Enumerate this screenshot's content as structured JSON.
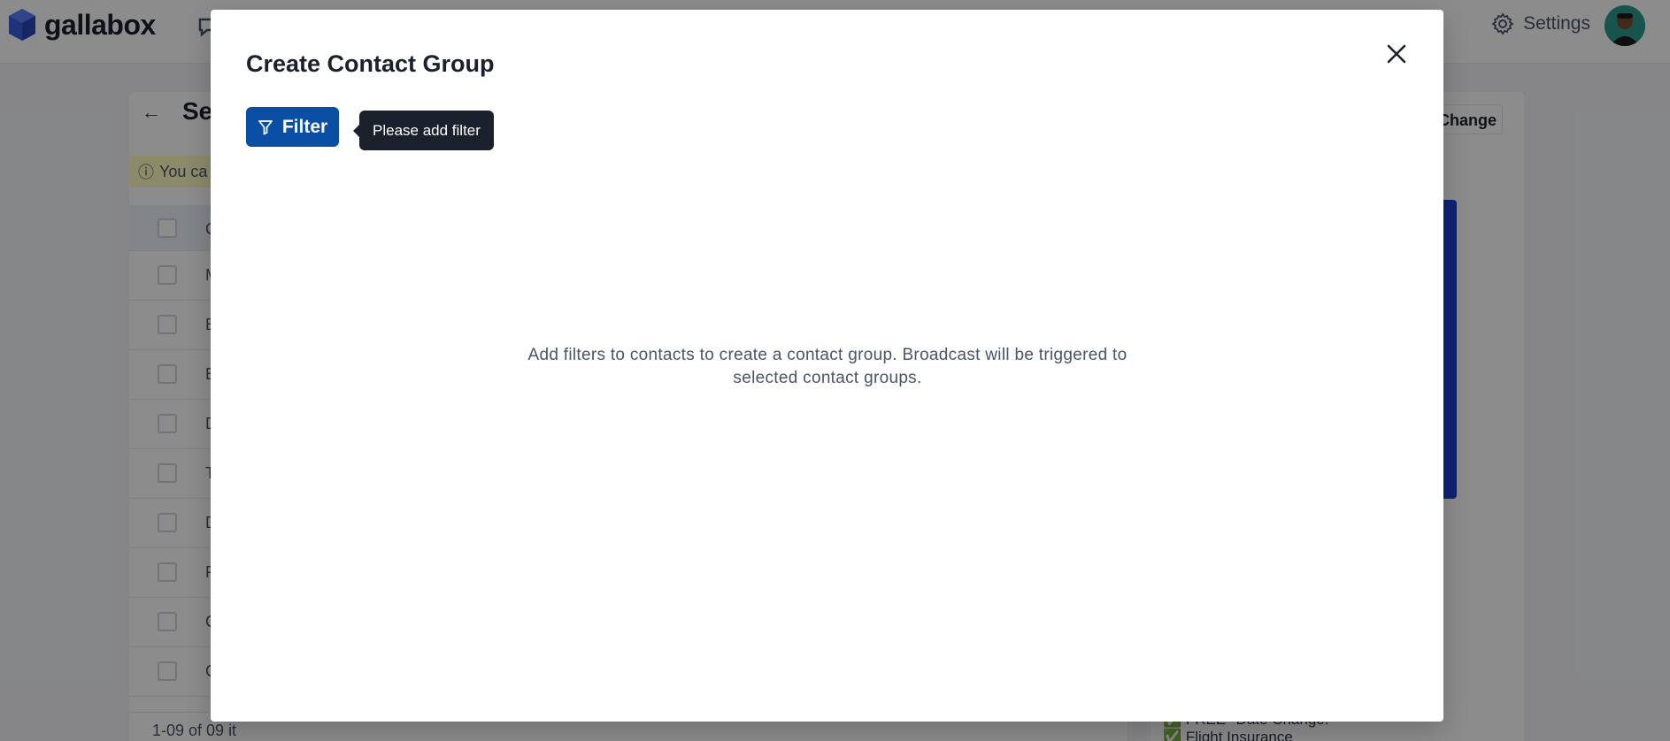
{
  "app": {
    "logo_text": "gallabox",
    "settings_label": "Settings",
    "brand_color": "#3b5bdb"
  },
  "background": {
    "page_title": "Se",
    "info_banner": "You ca",
    "change_button": "Change",
    "table_rows": [
      {
        "label": "C"
      },
      {
        "label": "M"
      },
      {
        "label": "E"
      },
      {
        "label": "E"
      },
      {
        "label": "D"
      },
      {
        "label": "T"
      },
      {
        "label": "D"
      },
      {
        "label": "P"
      },
      {
        "label": "C"
      },
      {
        "label": "C"
      }
    ],
    "pager_text": "1-09 of 09 it",
    "preview_lines": [
      "✅ FREE* Date Change.",
      "✅ Flight Insurance"
    ]
  },
  "modal": {
    "title": "Create Contact Group",
    "filter_button": "Filter",
    "tooltip": "Please add filter",
    "empty_message": "Add filters to contacts to create a contact group. Broadcast will be triggered to selected contact groups.",
    "accent_color": "#0a4fa3"
  }
}
